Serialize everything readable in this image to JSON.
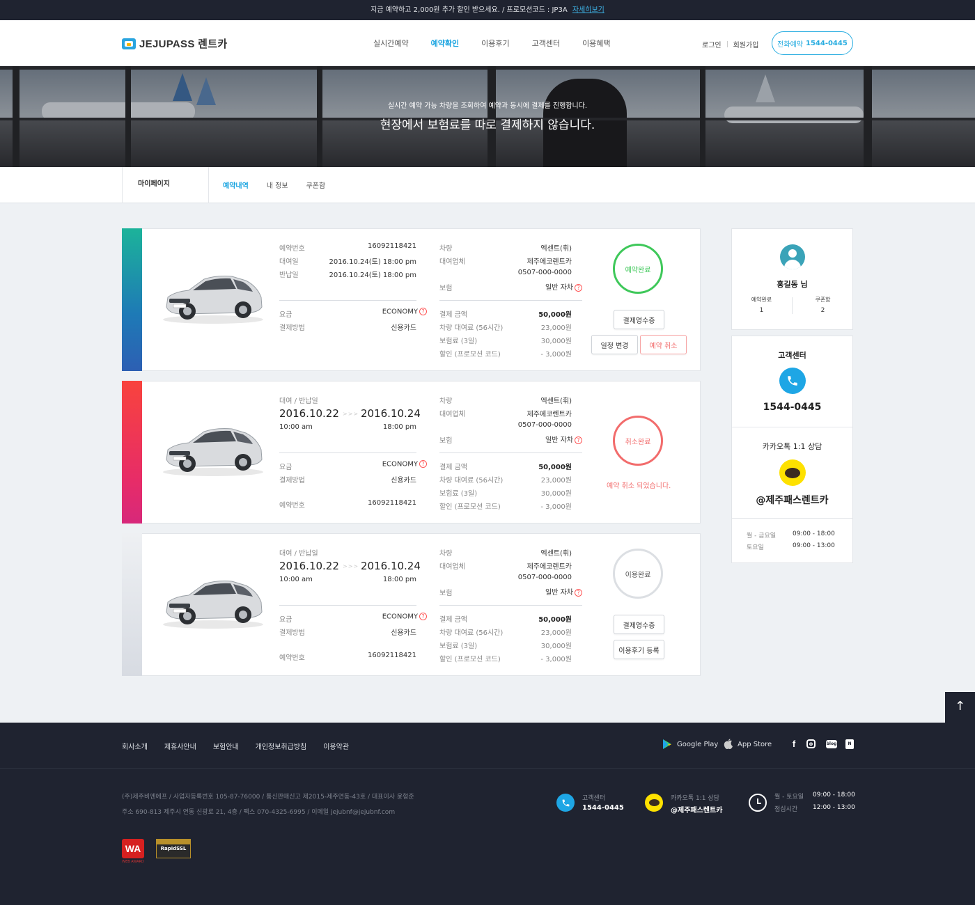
{
  "promo": {
    "text": "지금 예약하고 2,000원 추가 할인 받으세요. / 프로모션코드 : JP3A",
    "link": "자세히보기"
  },
  "header": {
    "logo": "JEJUPASS 렌트카",
    "nav": [
      "실시간예약",
      "예약확인",
      "이용후기",
      "고객센터",
      "이용혜택"
    ],
    "nav_active": "예약확인",
    "login": "로그인",
    "signup": "회원가입",
    "call_label": "전화예약",
    "call_number": "1544-0445"
  },
  "hero": {
    "line1": "실시간 예약 가능 차량을 조회하여 예약과 동시에 결제를 진행합니다.",
    "line2": "현장에서 보험료를 따로 결제하지 않습니다."
  },
  "subnav": {
    "title": "마이페이지",
    "tabs": [
      "예약내역",
      "내 정보",
      "쿠폰함"
    ]
  },
  "labels": {
    "booking_no": "예약번호",
    "rent_date": "대여일",
    "return_date": "반납일",
    "rent_return": "대여 / 반납일",
    "fee": "요금",
    "pay_method": "결제방법",
    "car": "차량",
    "company": "대여업체",
    "insurance": "보험",
    "total": "결제 금액",
    "rent_fee": "차량 대여료 (56시간)",
    "ins_fee": "보험료 (3일)",
    "discount": "할인 (프로모션 코드)"
  },
  "bookings": [
    {
      "booking_no": "16092118421",
      "rent": "2016.10.24(토) 18:00 pm",
      "ret": "2016.10.24(토) 18:00 pm",
      "fee": "ECONOMY",
      "pay": "신용카드",
      "car": "엑센트(휘)",
      "company": "제주에코렌트카",
      "phone": "0507-000-0000",
      "insurance": "일반 자차",
      "total": "50,000원",
      "rent_fee": "23,000원",
      "ins_fee": "30,000원",
      "discount": "- 3,000원",
      "status": "예약완료",
      "btn_receipt": "결제영수증",
      "btn_change": "일정 변경",
      "btn_cancel": "예약 취소"
    },
    {
      "start_date": "2016.10.22",
      "end_date": "2016.10.24",
      "start_time": "10:00 am",
      "end_time": "18:00 pm",
      "fee": "ECONOMY",
      "pay": "신용카드",
      "booking_no": "16092118421",
      "car": "엑센트(휘)",
      "company": "제주에코렌트카",
      "phone": "0507-000-0000",
      "insurance": "일반 자차",
      "total": "50,000원",
      "rent_fee": "23,000원",
      "ins_fee": "30,000원",
      "discount": "- 3,000원",
      "status": "취소완료",
      "cancel_msg": "예약 취소 되었습니다."
    },
    {
      "start_date": "2016.10.22",
      "end_date": "2016.10.24",
      "start_time": "10:00 am",
      "end_time": "18:00 pm",
      "fee": "ECONOMY",
      "pay": "신용카드",
      "booking_no": "16092118421",
      "car": "엑센트(휘)",
      "company": "제주에코렌트카",
      "phone": "0507-000-0000",
      "insurance": "일반 자차",
      "total": "50,000원",
      "rent_fee": "23,000원",
      "ins_fee": "30,000원",
      "discount": "- 3,000원",
      "status": "이용완료",
      "btn_receipt": "결제영수증",
      "btn_review": "이용후기 등록"
    }
  ],
  "profile": {
    "name": "홍길동 님",
    "stat1_label": "예약완료",
    "stat1_value": "1",
    "stat2_label": "쿠폰함",
    "stat2_value": "2"
  },
  "support": {
    "title": "고객센터",
    "phone": "1544-0445",
    "kakao_title": "카카오톡 1:1 상담",
    "kakao_id": "@제주패스렌트카",
    "hours": [
      {
        "day": "월 - 금요일",
        "time": "09:00 - 18:00"
      },
      {
        "day": "토요일",
        "time": "09:00 - 13:00"
      }
    ]
  },
  "footer": {
    "links": [
      "회사소개",
      "제휴사안내",
      "보험안내",
      "개인정보취급방침",
      "이용약관"
    ],
    "google_play": "Google Play",
    "app_store": "App Store",
    "info1": "(주)제주비엔에프   /   사업자등록번호 105-87-76000   /   통신판매신고 제2015-제주연동-43호   /   대표이사 윤형준",
    "info2": "주소 690-813  제주시 연동 신광로 21, 4층   /   팩스 070-4325-6995   /   이메일 jejubnf@jejubnf.com",
    "cs_label": "고객센터",
    "cs_value": "1544-0445",
    "kakao_label": "카카오톡 1:1 상담",
    "kakao_value": "@제주패스렌트카",
    "hours": [
      {
        "day": "월 - 토요일",
        "time": "09:00 - 18:00"
      },
      {
        "day": "점심시간",
        "time": "12:00 - 13:00"
      }
    ],
    "award": "WEB AWARD",
    "ssl": "RapidSSL"
  },
  "colors": {
    "accent": "#1aa4e0",
    "done": "#3fc85a",
    "cancel": "#f26c6c",
    "used": "#dcdfe3",
    "dark": "#1f2330"
  }
}
